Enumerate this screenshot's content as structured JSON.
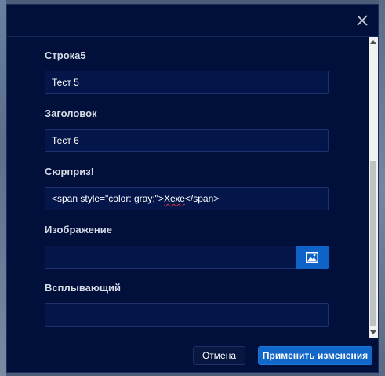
{
  "dialog": {
    "fields": [
      {
        "label": "Строка5",
        "value": "Тест 5"
      },
      {
        "label": "Заголовок",
        "value": "Тест 6"
      },
      {
        "label": "Сюрприз!",
        "value_prefix": "<span style=\"color: gray;\">",
        "value_misspelled": "Хехе",
        "value_suffix": "</span>"
      },
      {
        "label": "Изображение",
        "value": ""
      },
      {
        "label": "Всплывающий",
        "value": ""
      }
    ],
    "buttons": {
      "cancel": "Отмена",
      "apply": "Применить изменения"
    },
    "icons": {
      "close": "close-icon",
      "image": "image-icon"
    },
    "colors": {
      "background": "#01103a",
      "input_background": "#04154a",
      "accent": "#1268c9",
      "label": "#d7dbe6"
    }
  }
}
